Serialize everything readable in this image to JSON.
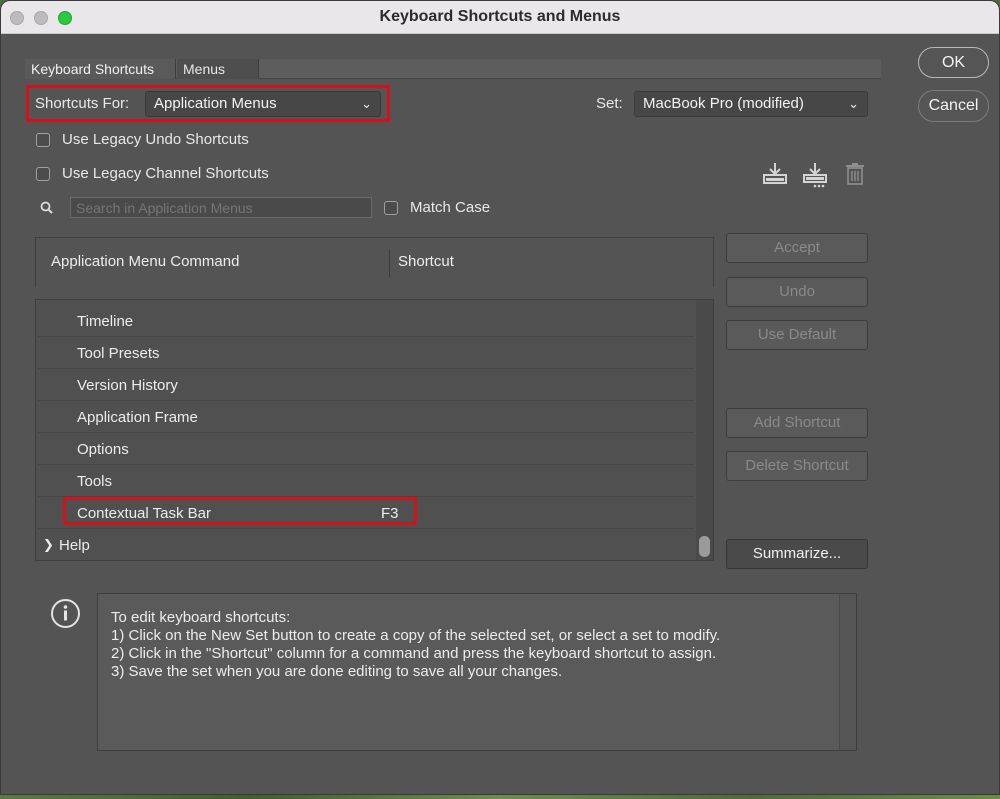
{
  "window": {
    "title": "Keyboard Shortcuts and Menus"
  },
  "tabs": [
    {
      "label": "Keyboard Shortcuts",
      "active": true
    },
    {
      "label": "Menus",
      "active": false
    }
  ],
  "shortcuts_for": {
    "label": "Shortcuts For:",
    "value": "Application Menus"
  },
  "set": {
    "label": "Set:",
    "value": "MacBook Pro (modified)"
  },
  "options": {
    "legacy_undo": {
      "label": "Use Legacy Undo Shortcuts",
      "checked": false
    },
    "legacy_channel": {
      "label": "Use Legacy Channel Shortcuts",
      "checked": false
    },
    "match_case": {
      "label": "Match Case",
      "checked": false
    }
  },
  "search": {
    "placeholder": "Search in Application Menus",
    "value": ""
  },
  "table": {
    "headers": [
      "Application Menu Command",
      "Shortcut"
    ],
    "rows": [
      {
        "command": "Timeline",
        "shortcut": ""
      },
      {
        "command": "Tool Presets",
        "shortcut": ""
      },
      {
        "command": "Version History",
        "shortcut": ""
      },
      {
        "command": "Application Frame",
        "shortcut": ""
      },
      {
        "command": "Options",
        "shortcut": ""
      },
      {
        "command": "Tools",
        "shortcut": ""
      },
      {
        "command": "Contextual Task Bar",
        "shortcut": "F3",
        "highlighted": true
      },
      {
        "command": "Help",
        "shortcut": "",
        "collapsed": true
      }
    ]
  },
  "buttons": {
    "ok": "OK",
    "cancel": "Cancel",
    "accept": "Accept",
    "undo": "Undo",
    "use_default": "Use Default",
    "add_shortcut": "Add Shortcut",
    "delete_shortcut": "Delete Shortcut",
    "summarize": "Summarize..."
  },
  "info": {
    "lines": [
      "To edit keyboard shortcuts:",
      "1) Click on the New Set button to create a copy of the selected set, or select a set to modify.",
      "2) Click in the \"Shortcut\" column for a command and press the keyboard shortcut to assign.",
      "3) Save the set when you are done editing to save all your changes."
    ]
  },
  "colors": {
    "highlight": "#d3121c",
    "dialog_bg": "#545454",
    "titlebar_bg": "#e9e7e9"
  },
  "icons": {
    "save_set": "download-icon",
    "new_set": "download-dotted-icon",
    "delete_set": "trash-icon",
    "search": "search-icon",
    "info": "info-icon"
  }
}
